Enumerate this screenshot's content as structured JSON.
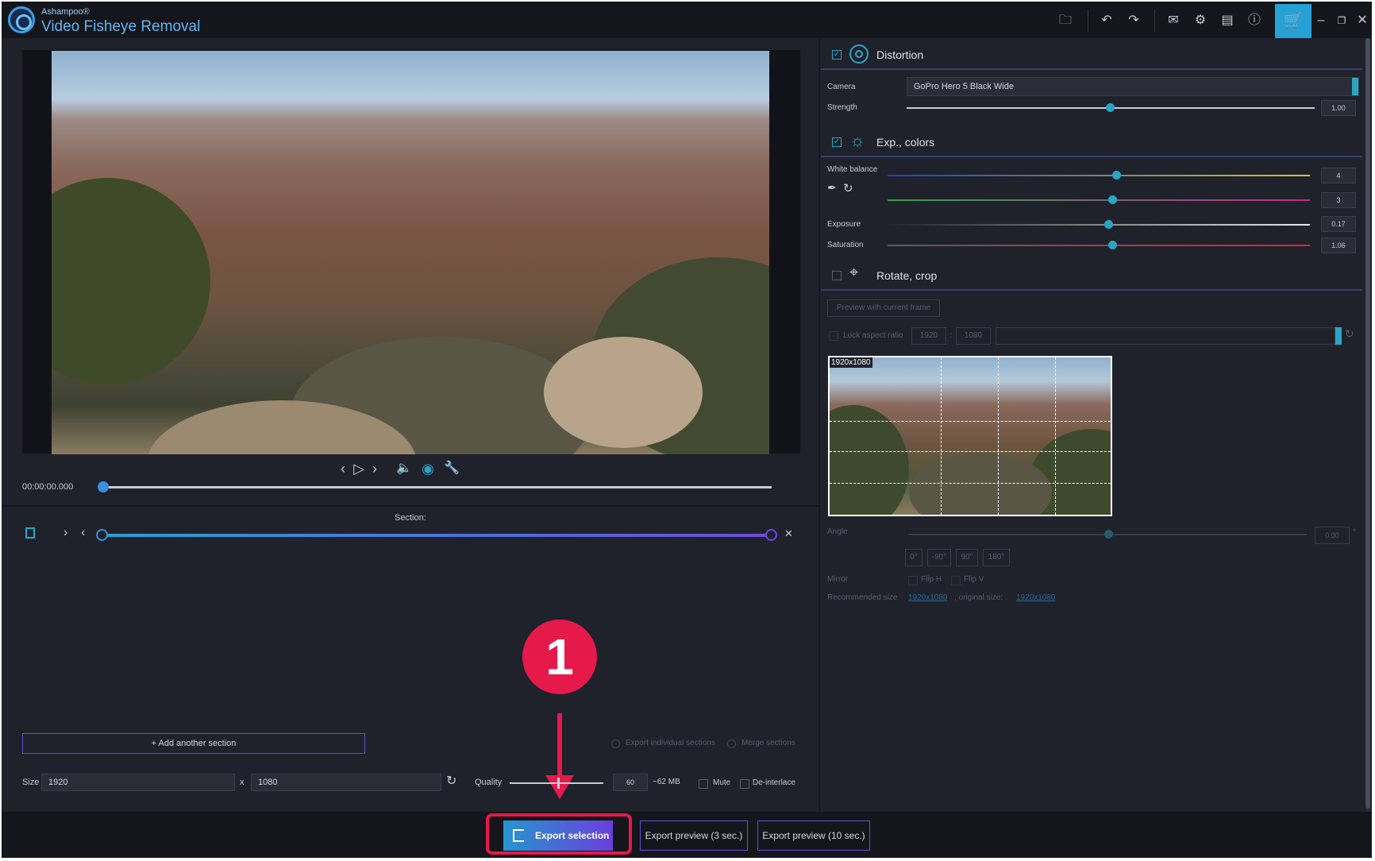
{
  "app": {
    "brand": "Ashampoo®",
    "title": "Video Fisheye Removal"
  },
  "player": {
    "timecode": "00:00:00.000",
    "section_label": "Section:"
  },
  "left_panel": {
    "add_section": "Add another section",
    "export_individual": "Export individual sections",
    "merge_sections": "Merge sections",
    "size_label": "Size",
    "width": "1920",
    "x": "x",
    "height": "1080",
    "quality_label": "Quality",
    "quality_value": "60",
    "file_size": "~62 MB",
    "mute": "Mute",
    "deinterlace": "De-interlace"
  },
  "bottom": {
    "export_selection": "Export selection",
    "export_preview_3": "Export preview (3 sec.)",
    "export_preview_10": "Export preview (10 sec.)"
  },
  "annotation": {
    "badge": "1",
    "color": "#e6194b"
  },
  "distortion": {
    "title": "Distortion",
    "camera_label": "Camera",
    "camera_value": "GoPro Hero 5 Black Wide",
    "strength_label": "Strength",
    "strength_value": "1.00",
    "strength_level": 0.47
  },
  "exp_colors": {
    "title": "Exp., colors",
    "white_balance_label": "White balance",
    "wb1_value": "4",
    "wb2_value": "3",
    "exposure_label": "Exposure",
    "exposure_value": "0.17",
    "saturation_label": "Saturation",
    "saturation_value": "1.06"
  },
  "rotate_crop": {
    "title": "Rotate, crop",
    "preview_button": "Preview with current frame",
    "lock_aspect": "Lock aspect ratio",
    "ratio_w": "1920",
    "colon": ":",
    "ratio_h": "1080",
    "thumb_label": "1920x1080",
    "angle_label": "Angle",
    "angle_value": "0.00",
    "degree_sign": "°",
    "angle_buttons": [
      "0°",
      "-90°",
      "90°",
      "180°"
    ],
    "mirror_label": "Mirror",
    "flip_h": "Flip H",
    "flip_v": "Flip V",
    "recommended_label": "Recommended size",
    "recommended_value": "1920x1080",
    "original_label": ", original size:",
    "original_value": "1920x1080"
  },
  "colors": {
    "accent": "#2aa6c4",
    "export_gradient_start": "#2596d0",
    "export_gradient_end": "#6a3fdc",
    "panel_bg": "#1f212b"
  }
}
